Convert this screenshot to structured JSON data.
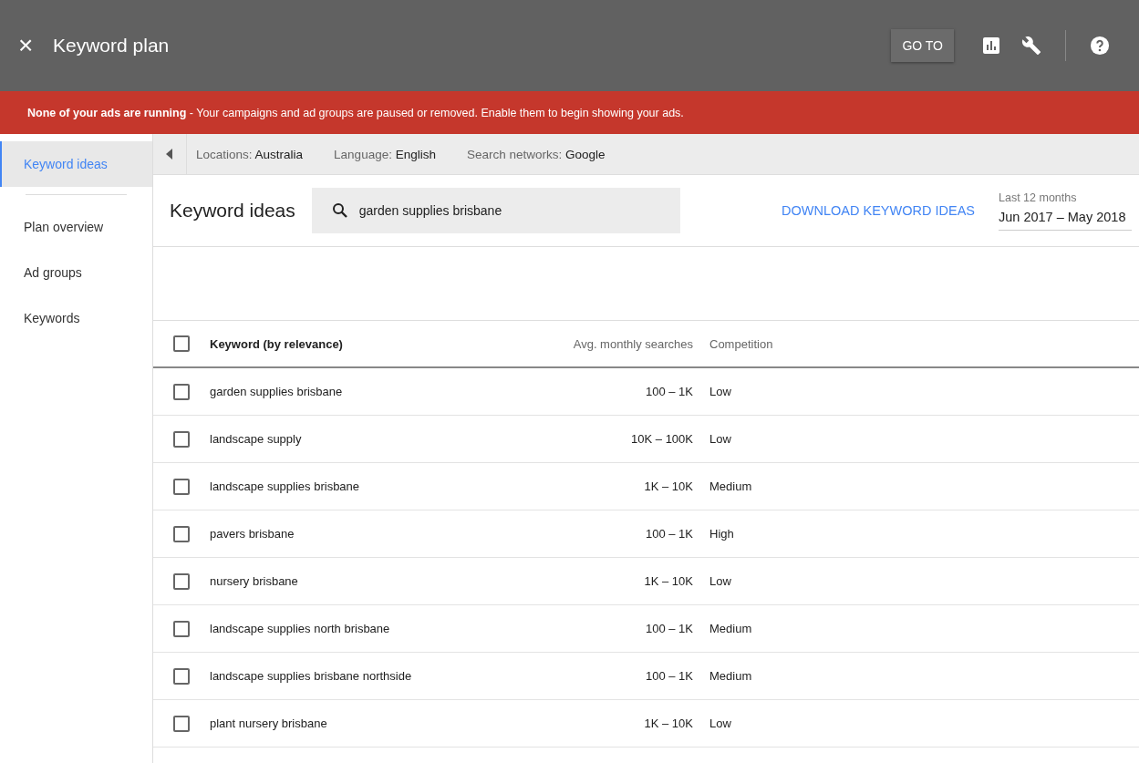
{
  "app_bar": {
    "close": "×",
    "title": "Keyword plan",
    "goto_button": "GO TO"
  },
  "banner": {
    "message": "**None of your ads are running** - Your campaigns and ad groups are paused or removed. Enable them to begin showing your ads."
  },
  "sidebar": {
    "items": [
      {
        "label": "Keyword ideas",
        "selected": true
      },
      {
        "label": "Plan overview",
        "selected": false
      },
      {
        "label": "Ad groups",
        "selected": false
      },
      {
        "label": "Keywords",
        "selected": false
      }
    ]
  },
  "filters": [
    {
      "label": "Locations:",
      "value": "Australia"
    },
    {
      "label": "Language:",
      "value": "English"
    },
    {
      "label": "Search networks:",
      "value": "Google"
    }
  ],
  "header": {
    "title": "Keyword ideas",
    "search": "garden supplies brisbane",
    "download": "DOWNLOAD KEYWORD IDEAS",
    "date_label": "Last 12 months",
    "date_range": "Jun 2017 – May 2018"
  },
  "table": {
    "columns": [
      "Keyword (by relevance)",
      "Avg. monthly searches",
      "Competition"
    ],
    "header_checked": false,
    "rows": [
      {
        "keyword": "garden supplies brisbane",
        "searches": "100 – 1K",
        "competition": "Low",
        "checked": false
      },
      {
        "keyword": "landscape supply",
        "searches": "10K – 100K",
        "competition": "Low",
        "checked": false
      },
      {
        "keyword": "landscape supplies brisbane",
        "searches": "1K – 10K",
        "competition": "Medium",
        "checked": false
      },
      {
        "keyword": "pavers brisbane",
        "searches": "100 – 1K",
        "competition": "High",
        "checked": false
      },
      {
        "keyword": "nursery brisbane",
        "searches": "1K – 10K",
        "competition": "Low",
        "checked": false
      },
      {
        "keyword": "landscape supplies north brisbane",
        "searches": "100 – 1K",
        "competition": "Medium",
        "checked": false
      },
      {
        "keyword": "landscape supplies brisbane northside",
        "searches": "100 – 1K",
        "competition": "Medium",
        "checked": false
      },
      {
        "keyword": "plant nursery brisbane",
        "searches": "1K – 10K",
        "competition": "Low",
        "checked": false
      }
    ]
  }
}
